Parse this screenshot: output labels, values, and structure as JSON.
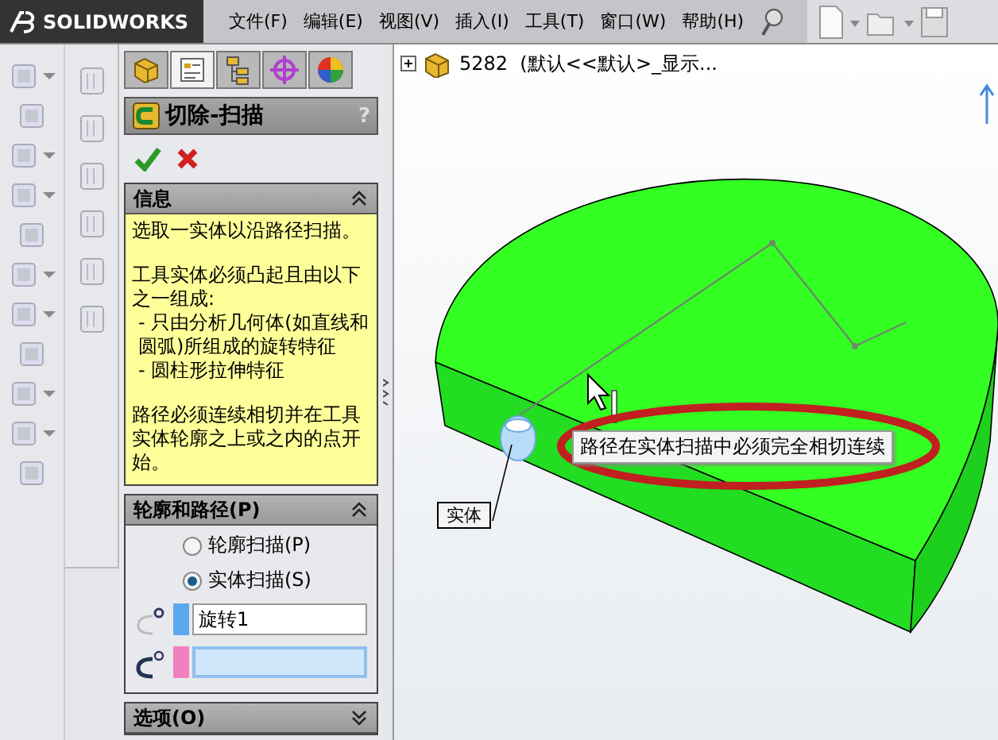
{
  "app": {
    "logo": "SOLIDWORKS"
  },
  "menu": [
    {
      "label": "文件(F)"
    },
    {
      "label": "编辑(E)"
    },
    {
      "label": "视图(V)"
    },
    {
      "label": "插入(I)"
    },
    {
      "label": "工具(T)"
    },
    {
      "label": "窗口(W)"
    },
    {
      "label": "帮助(H)"
    }
  ],
  "panel_tabs": [
    {
      "kind": "part",
      "selected": false
    },
    {
      "kind": "property",
      "selected": true
    },
    {
      "kind": "config",
      "selected": false
    },
    {
      "kind": "target",
      "selected": false
    },
    {
      "kind": "appearance",
      "selected": false
    }
  ],
  "feature": {
    "title": "切除-扫描",
    "help": "?"
  },
  "info": {
    "title": "信息",
    "expanded": true,
    "paragraphs": [
      {
        "lines": [
          "选取一实体以沿路径扫描。"
        ]
      },
      {
        "lines": [
          "工具实体必须凸起且由以下之一组成:",
          "- 只由分析几何体(如直线和圆弧)所组成的旋转特征",
          "- 圆柱形拉伸特征"
        ]
      },
      {
        "lines": [
          "路径必须连续相切并在工具实体轮廓之上或之内的点开始。"
        ]
      }
    ]
  },
  "profile_path": {
    "title": "轮廓和路径(P)",
    "expanded": true,
    "options": [
      {
        "label": "轮廓扫描(P)",
        "selected": false
      },
      {
        "label": "实体扫描(S)",
        "selected": true
      }
    ],
    "fields": [
      {
        "value": "旋转1",
        "color": "#5aa8f0",
        "focused": false
      },
      {
        "color": "#f080c0",
        "focused": true
      }
    ]
  },
  "options_section": {
    "title": "选项(O)",
    "expanded": false
  },
  "tree": {
    "label": "5282  (默认<<默认>_显示...",
    "expanded": false
  },
  "viewport": {
    "tooltip": "路径在实体扫描中必须完全相切连续",
    "callout": "实体"
  }
}
